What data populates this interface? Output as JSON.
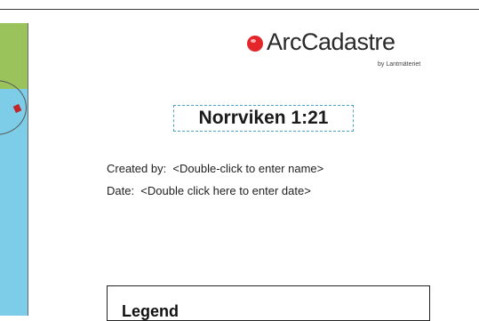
{
  "logo": {
    "brand": "ArcCadastre",
    "byline": "by Lantmäteriet",
    "brand_color": "#e4262b"
  },
  "layout_title": "Norrviken 1:21",
  "metadata": {
    "created_by": "Created by:  <Double-click to enter name>",
    "date": "Date:  <Double click here to enter date>"
  },
  "legend": {
    "title": "Legend"
  },
  "map": {
    "land_color": "#9ac35c",
    "water_color": "#7ecde8"
  }
}
